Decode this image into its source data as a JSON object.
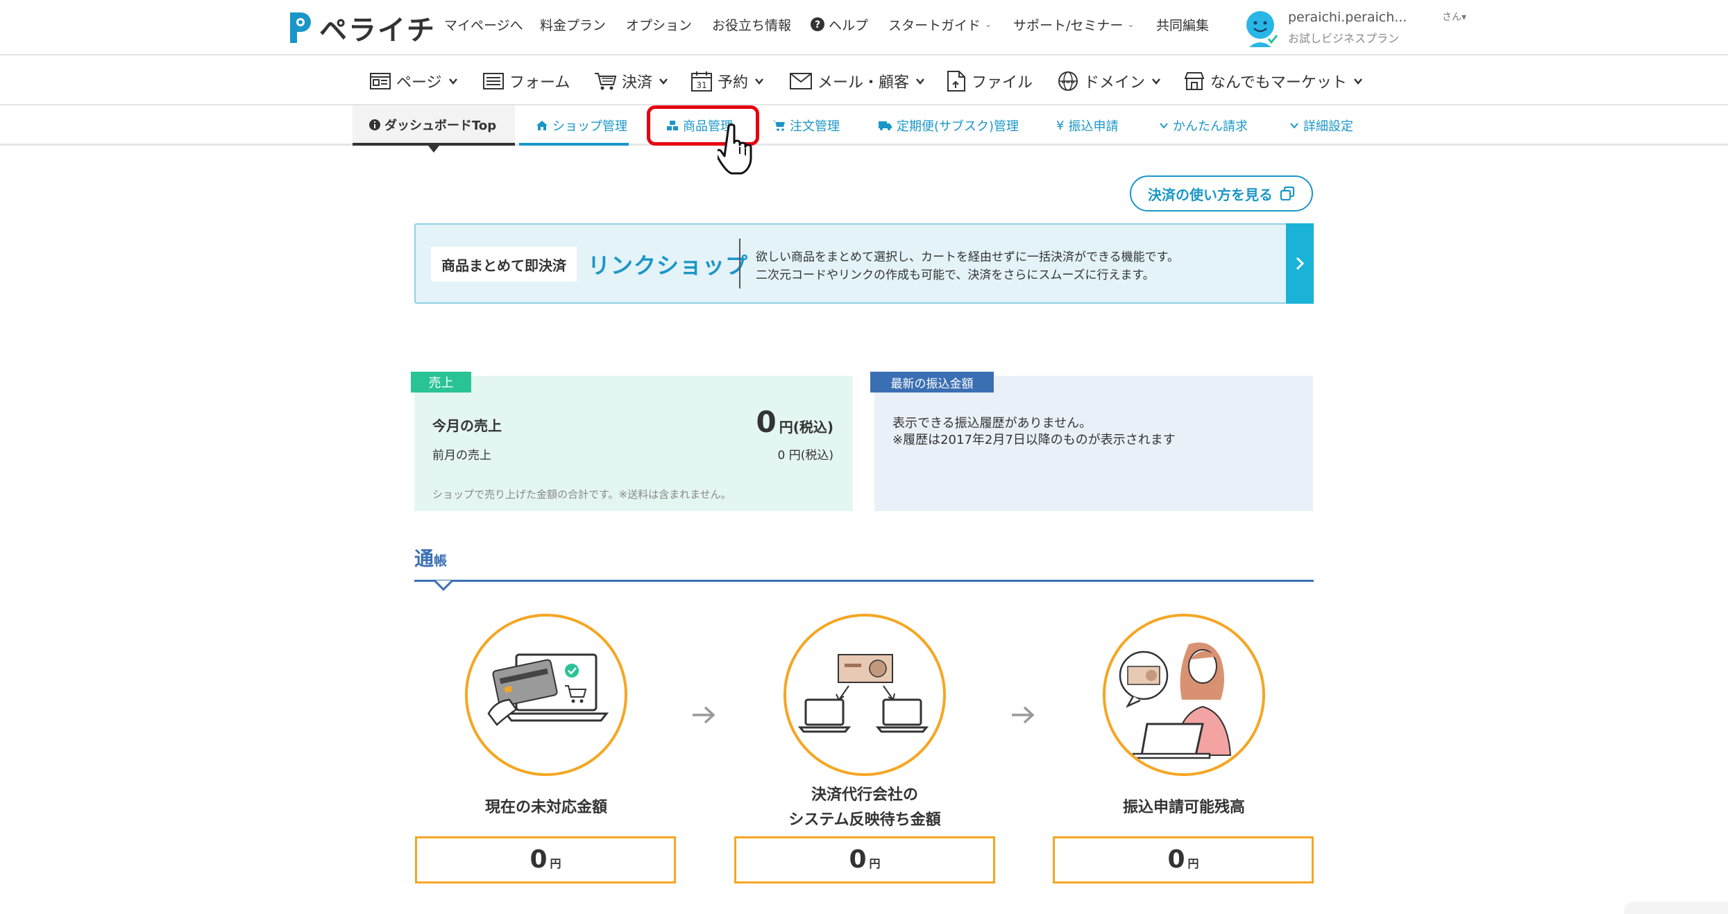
{
  "header": {
    "logo_text": "ペライチ",
    "nav": [
      "マイページへ",
      "料金プラン",
      "オプション",
      "お役立ち情報",
      "ヘルプ",
      "スタートガイド",
      "サポート/セミナー",
      "共同編集"
    ],
    "user_name": "peraichi.peraich...",
    "user_suffix": "さん",
    "user_plan": "お試しビジネスプラン"
  },
  "main_nav": {
    "items": [
      "ページ",
      "フォーム",
      "決済",
      "予約",
      "メール・顧客",
      "ファイル",
      "ドメイン",
      "なんでもマーケット"
    ],
    "calendar_day": "31"
  },
  "sub_nav": {
    "items": [
      "ダッシュボードTop",
      "ショップ管理",
      "商品管理",
      "注文管理",
      "定期便(サブスク)管理",
      "振込申請",
      "かんたん請求",
      "詳細設定"
    ],
    "yen_prefix": "¥"
  },
  "help_button": "決済の使い方を見る",
  "banner": {
    "tag": "商品まとめて即決済",
    "title": "リンクショップ",
    "desc_line1": "欲しい商品をまとめて選択し、カートを経由せずに一括決済ができる機能です。",
    "desc_line2": "二次元コードやリンクの作成も可能で、決済をさらにスムーズに行えます。"
  },
  "sales": {
    "tag": "売上",
    "this_month_label": "今月の売上",
    "this_month_value": "0",
    "this_month_unit": "円(税込)",
    "last_month_label": "前月の売上",
    "last_month_value": "0 円(税込)",
    "note": "ショップで売り上げた金額の合計です。※送料は含まれません。"
  },
  "transfer": {
    "tag": "最新の振込金額",
    "line1": "表示できる振込履歴がありません。",
    "line2": "※履歴は2017年2月7日以降のものが表示されます"
  },
  "passbook": {
    "title_big": "通",
    "title_small": "帳",
    "steps": [
      {
        "label_line1": "現在の未対応金額",
        "label_line2": "",
        "amount": "0",
        "unit": "円"
      },
      {
        "label_line1": "決済代行会社の",
        "label_line2": "システム反映待ち金額",
        "amount": "0",
        "unit": "円"
      },
      {
        "label_line1": "振込申請可能残高",
        "label_line2": "",
        "amount": "0",
        "unit": "円"
      }
    ]
  },
  "colors": {
    "accent_blue": "#1a96c8",
    "sales_green": "#29c396",
    "transfer_navy": "#3b6fb3",
    "passbook_orange": "#f5a623",
    "highlight_red": "#e60012"
  }
}
